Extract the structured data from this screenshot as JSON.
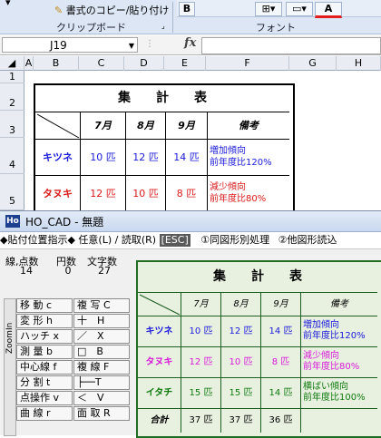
{
  "excel": {
    "ribbon": {
      "copy_format": "書式のコピー/貼り付け",
      "clipboard_group": "クリップボード",
      "font_group": "フォント",
      "bold": "B",
      "font_color": "A"
    },
    "namebox": "J19",
    "fx": "fx",
    "columns": [
      "A",
      "B",
      "C",
      "D",
      "E",
      "F",
      "G",
      "H"
    ],
    "rows": [
      "1",
      "2",
      "3",
      "4",
      "5"
    ],
    "table": {
      "title": "集　　計　　表",
      "months": [
        "7月",
        "8月",
        "9月"
      ],
      "remarks_header": "備考",
      "rows": [
        {
          "name": "キツネ",
          "vals": [
            "10 匹",
            "12 匹",
            "14 匹"
          ],
          "note1": "増加傾向",
          "note2": "前年度比120%",
          "name_color": "#1a1ad9",
          "val_color": "#1a1ad9",
          "note_color": "#1a1ad9"
        },
        {
          "name": "タヌキ",
          "vals": [
            "12 匹",
            "10 匹",
            "8 匹"
          ],
          "note1": "減少傾向",
          "note2": "前年度比80%",
          "name_color": "#d91a1a",
          "val_color": "#d91a1a",
          "note_color": "#d91a1a"
        }
      ]
    }
  },
  "cad": {
    "title": "HO_CAD - 無題",
    "command": "◆貼付位置指示◆ 任意(L) / 読取(R)",
    "esc": "[ESC]",
    "option1": "①同図形別処理",
    "option2": "②他図形読込",
    "stats_headers": [
      "線,点数",
      "円数",
      "文字数"
    ],
    "stats_values": [
      "14",
      "0",
      "27"
    ],
    "zoom_label": "ZoomIn",
    "tools": [
      [
        "移 動 c",
        "複 写 C"
      ],
      [
        "変 形 h",
        "十　H"
      ],
      [
        "ハッチ x",
        "／　X"
      ],
      [
        "測 量 b",
        "□　B"
      ],
      [
        "中心線 f",
        "複 線 F"
      ],
      [
        "分 割 t",
        "├──T"
      ],
      [
        "点操作 v",
        "＜　V"
      ],
      [
        "曲 線 r",
        "面 取 R"
      ]
    ],
    "table": {
      "title": "集　　計　　表",
      "months": [
        "7月",
        "8月",
        "9月"
      ],
      "remarks_header": "備考",
      "rows": [
        {
          "name": "キツネ",
          "vals": [
            "10 匹",
            "12 匹",
            "14 匹"
          ],
          "note1": "増加傾向",
          "note2": "前年度比120%",
          "name_color": "#1a1ad9",
          "val_color": "#1a1ad9",
          "note_color": "#1a1ad9"
        },
        {
          "name": "タヌキ",
          "vals": [
            "12 匹",
            "10 匹",
            "8 匹"
          ],
          "note1": "減少傾向",
          "note2": "前年度比80%",
          "name_color": "#d81ad8",
          "val_color": "#d81ad8",
          "note_color": "#d81ad8"
        },
        {
          "name": "イタチ",
          "vals": [
            "15 匹",
            "15 匹",
            "14 匹"
          ],
          "note1": "横ばい傾向",
          "note2": "前年度比100%",
          "name_color": "#0f7a0f",
          "val_color": "#0f7a0f",
          "note_color": "#0f7a0f"
        }
      ],
      "total": {
        "name": "合計",
        "vals": [
          "37 匹",
          "37 匹",
          "36 匹"
        ]
      }
    }
  }
}
